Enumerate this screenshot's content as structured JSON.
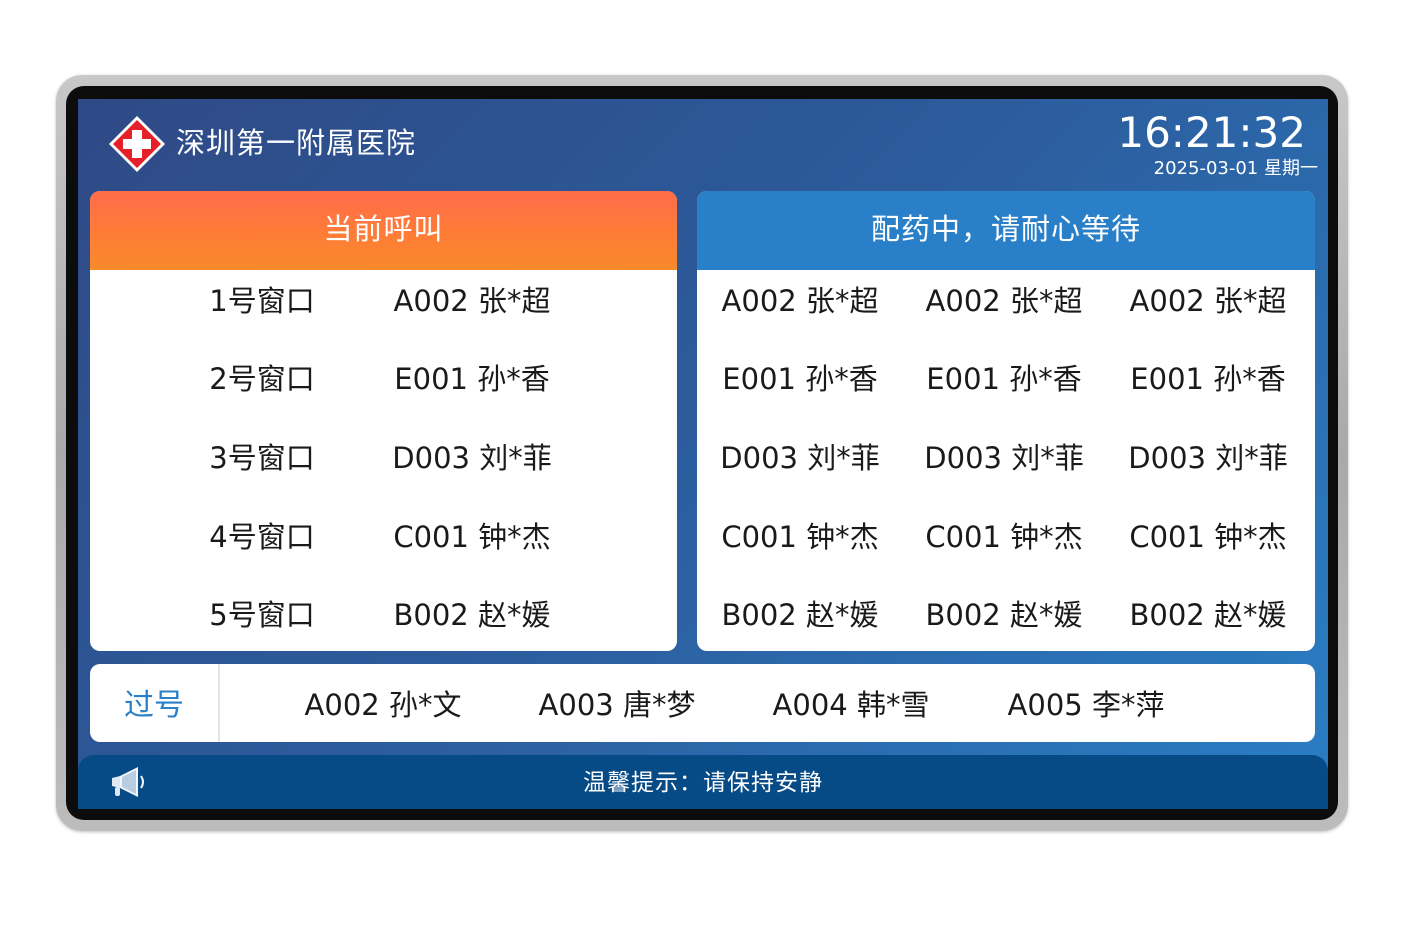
{
  "header": {
    "hospital_name": "深圳第一附属医院",
    "time": "16:21:32",
    "date": "2025-03-01 星期一",
    "logo_icon": "red-cross-icon"
  },
  "current_call": {
    "title": "当前呼叫",
    "rows": [
      {
        "window": "1号窗口",
        "patient": "A002 张*超"
      },
      {
        "window": "2号窗口",
        "patient": "E001 孙*香"
      },
      {
        "window": "3号窗口",
        "patient": "D003 刘*菲"
      },
      {
        "window": "4号窗口",
        "patient": "C001 钟*杰"
      },
      {
        "window": "5号窗口",
        "patient": "B002 赵*媛"
      }
    ],
    "header_color": "#ff7a3c"
  },
  "waiting": {
    "title": "配药中，请耐心等待",
    "rows": [
      [
        "A002 张*超",
        "A002 张*超",
        "A002 张*超"
      ],
      [
        "E001 孙*香",
        "E001 孙*香",
        "E001 孙*香"
      ],
      [
        "D003 刘*菲",
        "D003 刘*菲",
        "D003 刘*菲"
      ],
      [
        "C001 钟*杰",
        "C001 钟*杰",
        "C001 钟*杰"
      ],
      [
        "B002 赵*媛",
        "B002 赵*媛",
        "B002 赵*媛"
      ]
    ],
    "header_color": "#2a80c8"
  },
  "skipped": {
    "label": "过号",
    "items": [
      "A002 孙*文",
      "A003 唐*梦",
      "A004 韩*雪",
      "A005 李*萍"
    ]
  },
  "footer": {
    "tip": "温馨提示：请保持安静",
    "speaker_icon": "megaphone-icon"
  },
  "colors": {
    "background_start": "#2e4a86",
    "background_end": "#2a7ec4",
    "footer": "#064a86",
    "accent_blue": "#2a80c8"
  }
}
